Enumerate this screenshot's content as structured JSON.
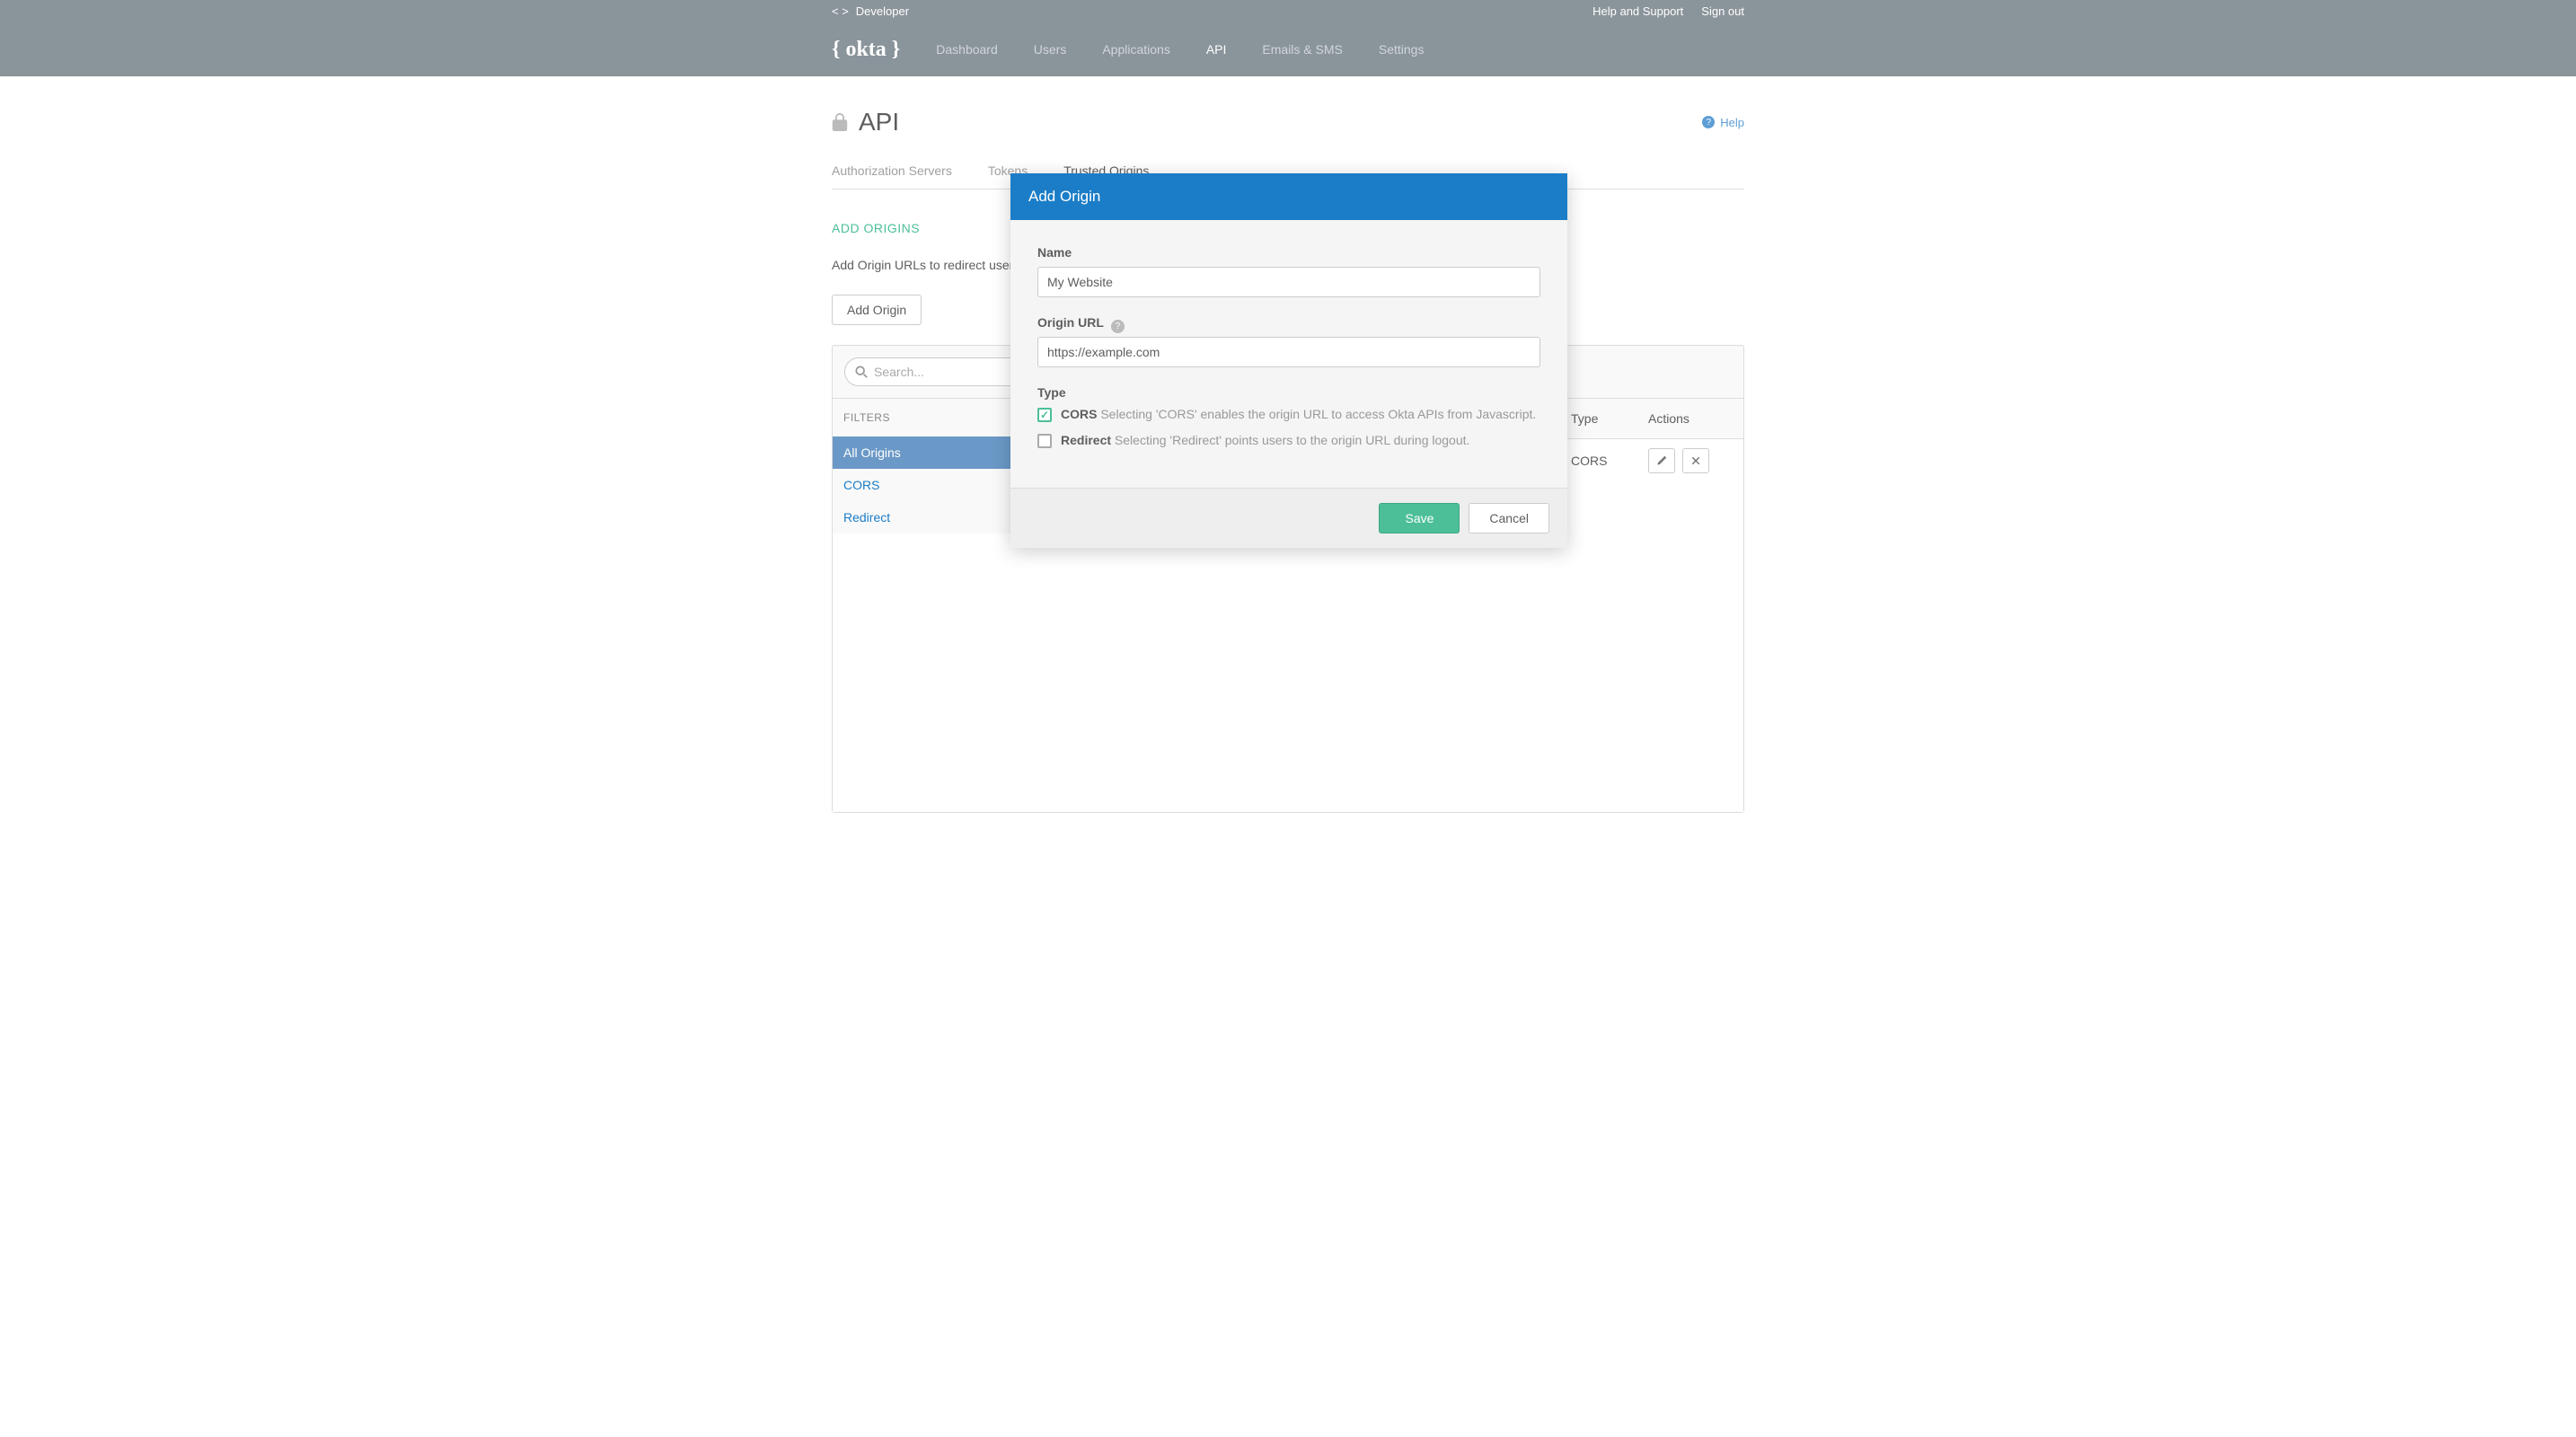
{
  "topbar": {
    "devLabel": "Developer",
    "helpLink": "Help and Support",
    "signOut": "Sign out"
  },
  "nav": {
    "logo": "{ okta }",
    "items": [
      "Dashboard",
      "Users",
      "Applications",
      "API",
      "Emails & SMS",
      "Settings"
    ],
    "activeIndex": 3
  },
  "page": {
    "title": "API",
    "helpLabel": "Help"
  },
  "tabs": {
    "items": [
      "Authorization Servers",
      "Tokens",
      "Trusted Origins"
    ],
    "activeIndex": 2
  },
  "section": {
    "title": "ADD ORIGINS",
    "desc": "Add Origin URLs to redirect users",
    "addButton": "Add Origin"
  },
  "search": {
    "placeholder": "Search..."
  },
  "filters": {
    "header": "FILTERS",
    "items": [
      "All Origins",
      "CORS",
      "Redirect"
    ],
    "selectedIndex": 0
  },
  "table": {
    "columns": [
      "Type",
      "Actions"
    ],
    "rows": [
      {
        "type": "CORS"
      }
    ]
  },
  "modal": {
    "title": "Add Origin",
    "nameLabel": "Name",
    "nameValue": "My Website",
    "urlLabel": "Origin URL",
    "urlValue": "https://example.com",
    "typeLabel": "Type",
    "corsLabel": "CORS",
    "corsDesc": "Selecting 'CORS' enables the origin URL to access Okta APIs from Javascript.",
    "redirectLabel": "Redirect",
    "redirectDesc": "Selecting 'Redirect' points users to the origin URL during logout.",
    "saveLabel": "Save",
    "cancelLabel": "Cancel"
  }
}
